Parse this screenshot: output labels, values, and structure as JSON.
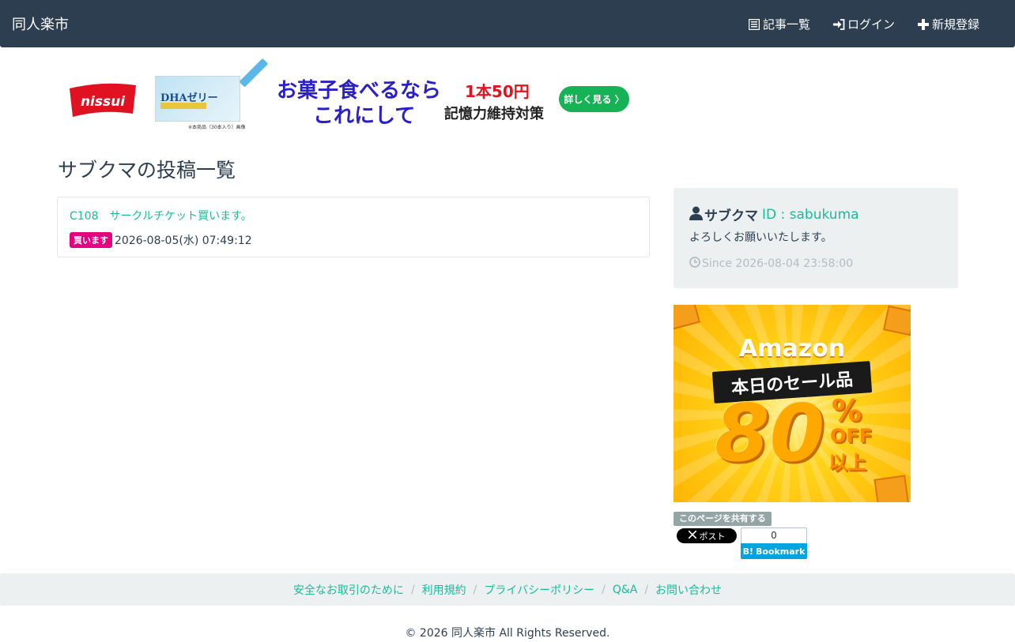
{
  "navbar": {
    "brand": "同人楽市",
    "items": [
      {
        "label": "記事一覧",
        "icon": "list-alt-icon"
      },
      {
        "label": "ログイン",
        "icon": "log-in-icon"
      },
      {
        "label": "新規登録",
        "icon": "plus-icon"
      }
    ]
  },
  "banner": {
    "logo_text": "nissui",
    "product_name": "DHAゼリー",
    "product_note": "※本商品（30本入り）画像",
    "headline_1": "お菓子食べるなら",
    "headline_2": "これにして",
    "price": "1本50円",
    "subtext": "記憶力維持対策",
    "cta": "詳しく見る 〉"
  },
  "page_title": "サブクマの投稿一覧",
  "posts": [
    {
      "title": "C108　サークルチケット買います。",
      "badge": "買います",
      "date": "2026-08-05(水) 07:49:12"
    }
  ],
  "profile": {
    "name": "サブクマ",
    "id_text": "ID : sabukuma",
    "bio": "よろしくお願いいたします。",
    "since": "Since 2026-08-04 23:58:00"
  },
  "amazon_ad": {
    "title": "Amazon",
    "band": "本日のセール品",
    "number": "80",
    "percent": "%",
    "off": "OFF",
    "suffix": "以上"
  },
  "share": {
    "label": "このページを共有する",
    "x_button": "ポスト",
    "hatena_count": "0",
    "hatena_label": "Bookmark"
  },
  "footer": {
    "links": [
      "安全なお取引のために",
      "利用規約",
      "プライバシーポリシー",
      "Q&A",
      "お問い合わせ"
    ],
    "copyright": "© 2026 同人楽市 All Rights Reserved."
  },
  "colors": {
    "navbar": "#2c3e50",
    "link": "#18bc9c",
    "badge": "#e4007f",
    "panel": "#ecf0f1"
  }
}
